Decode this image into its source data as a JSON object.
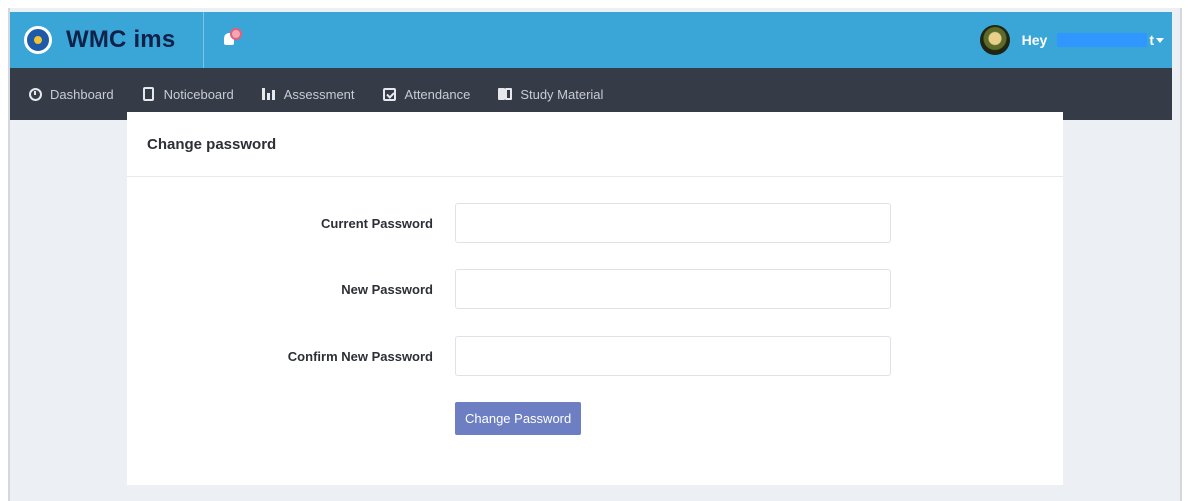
{
  "header": {
    "app_title": "WMC ims",
    "greeting": "Hey",
    "user_name_suffix": "t",
    "colors": {
      "topbar": "#3aa6d8",
      "navbar": "#363b48",
      "accent_button": "#6d7fc2"
    }
  },
  "nav": {
    "items": [
      {
        "label": "Dashboard",
        "icon": "dashboard-icon"
      },
      {
        "label": "Noticeboard",
        "icon": "noticeboard-icon"
      },
      {
        "label": "Assessment",
        "icon": "bar-chart-icon"
      },
      {
        "label": "Attendance",
        "icon": "calendar-check-icon"
      },
      {
        "label": "Study Material",
        "icon": "book-icon"
      }
    ]
  },
  "card": {
    "title": "Change password",
    "fields": {
      "current": {
        "label": "Current Password",
        "value": ""
      },
      "new": {
        "label": "New Password",
        "value": ""
      },
      "confirm": {
        "label": "Confirm New Password",
        "value": ""
      }
    },
    "submit_label": "Change Password"
  }
}
